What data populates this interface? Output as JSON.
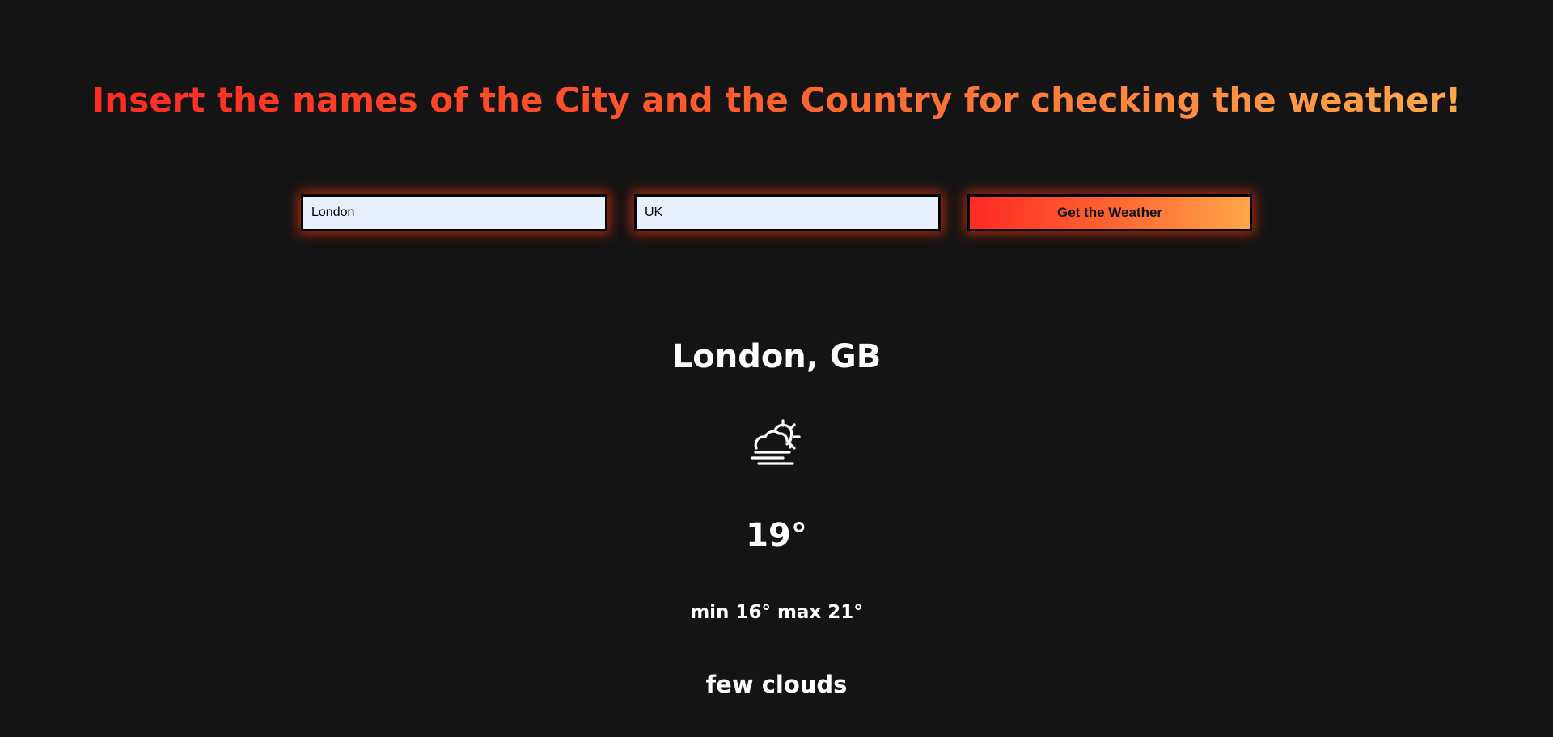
{
  "header": {
    "title": "Insert the names of the City and the Country for checking the weather!"
  },
  "form": {
    "city_value": "London",
    "country_value": "UK",
    "submit_label": "Get the Weather"
  },
  "result": {
    "location": "London, GB",
    "icon": "fog-partly-cloudy-sun-icon",
    "temperature": "19°",
    "min_max": "min 16° max 21°",
    "description": "few clouds"
  },
  "colors": {
    "background": "#141414",
    "accent_start": "#ff2a24",
    "accent_end": "#ffa84a",
    "input_background": "#e8f0fe",
    "text": "#ffffff"
  }
}
